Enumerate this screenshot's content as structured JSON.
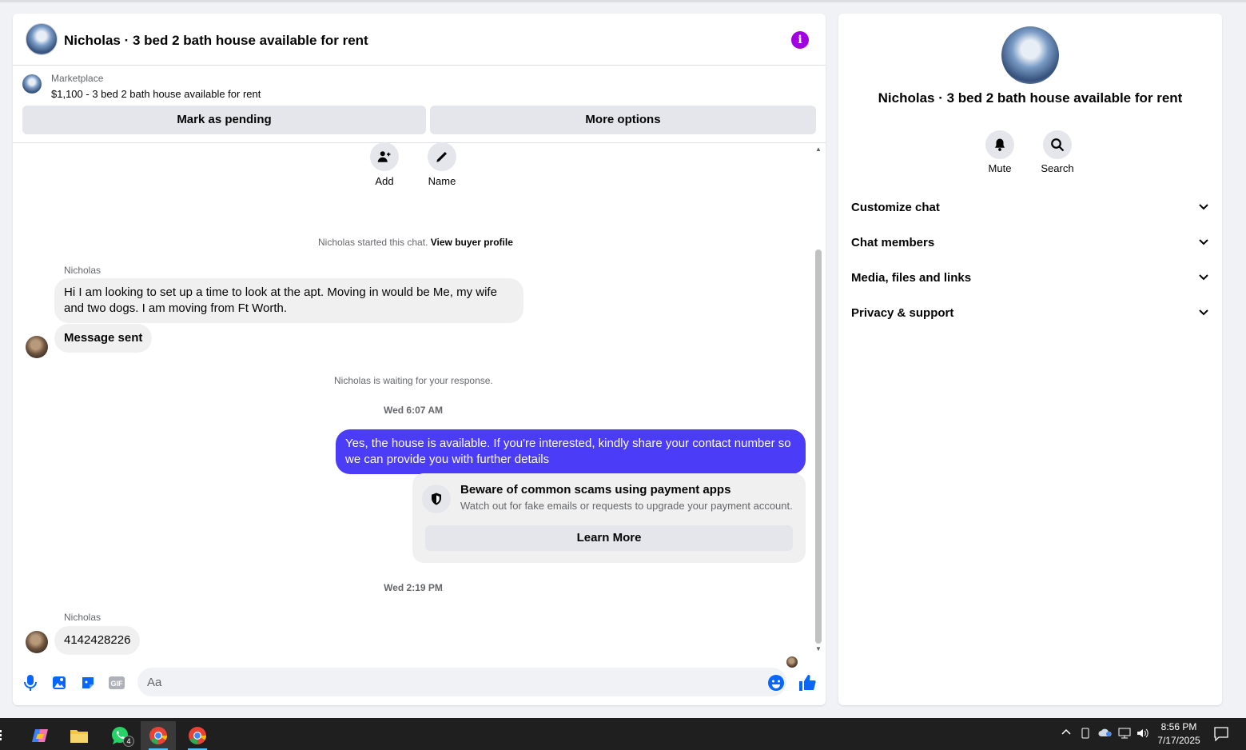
{
  "chat": {
    "title": "Nicholas · 3 bed 2 bath house available for rent",
    "listing_source": "Marketplace",
    "listing_name": "$1,100 - 3 bed 2 bath house available for rent",
    "mark_pending": "Mark as pending",
    "more_options": "More options",
    "add_label": "Add",
    "name_label": "Name",
    "started_note": "Nicholas started this chat.",
    "view_profile": "View buyer profile",
    "sender_1": "Nicholas",
    "msg_1": "Hi I am looking to set up a time to look at the apt. Moving in would be Me, my wife and two dogs. I am moving from Ft Worth.",
    "msg_2": "Message sent",
    "waiting_note": "Nicholas is waiting for your response.",
    "time_1": "Wed 6:07 AM",
    "msg_out": "Yes, the house is available. If you're interested, kindly share your contact number so we can provide you with further details",
    "scam_title": "Beware of common scams using payment apps",
    "scam_desc": "Watch out for fake emails or requests to upgrade your payment account.",
    "scam_button": "Learn More",
    "time_2": "Wed 2:19 PM",
    "sender_2": "Nicholas",
    "msg_3": "4142428226",
    "input_placeholder": "Aa"
  },
  "side": {
    "title": "Nicholas · 3 bed 2 bath house available for rent",
    "mute": "Mute",
    "search": "Search",
    "sections": [
      "Customize chat",
      "Chat members",
      "Media, files and links",
      "Privacy & support"
    ]
  },
  "taskbar": {
    "whatsapp_badge": "4",
    "time": "8:56 PM",
    "date": "7/17/2025"
  },
  "colors": {
    "accent": "#0866ff",
    "outgoing_bubble": "#4a3cf7",
    "info_icon": "#a200e0"
  }
}
